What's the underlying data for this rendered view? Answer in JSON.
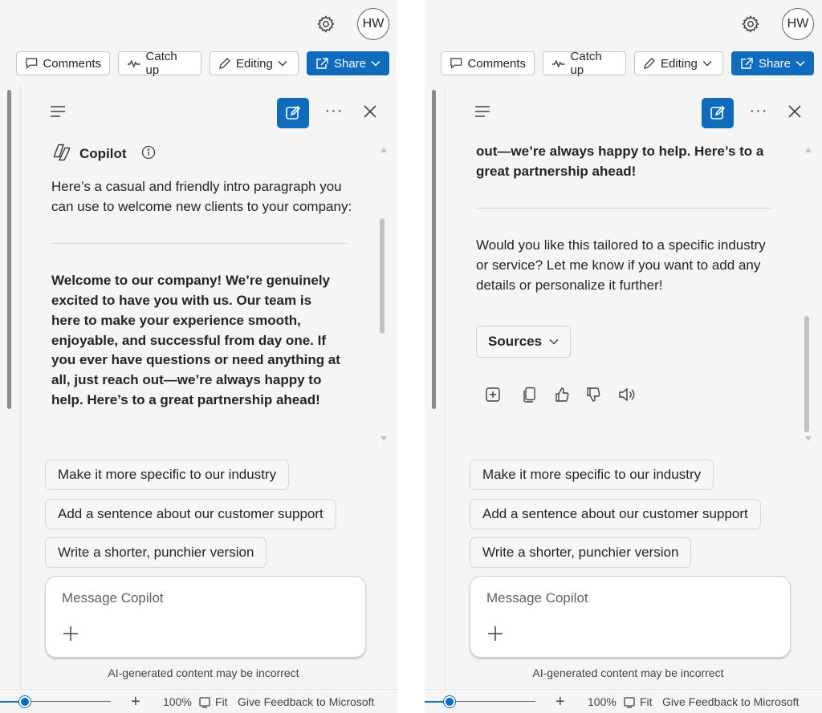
{
  "header": {
    "avatar_initials": "HW",
    "settings_icon": "gear-icon"
  },
  "toolbar": {
    "comments_label": "Comments",
    "catchup_label": "Catch up",
    "editing_label": "Editing",
    "share_label": "Share"
  },
  "copilot": {
    "title": "Copilot",
    "intro": "Here’s a casual and friendly intro paragraph you can use to welcome new clients to your company:",
    "draft_paragraph": "Welcome to our company! We’re genuinely excited to have you with us. Our team is here to make your experience smooth, enjoyable, and successful from day one. If you ever have questions or need anything at all, just reach out—we’re always happy to help. Here’s to a great partnership ahead!",
    "draft_tail": "out—we’re always happy to help. Here’s to a great partnership ahead!",
    "followup": "Would you like this tailored to a specific industry or service? Let me know if you want to add any details or personalize it further!",
    "sources_label": "Sources",
    "suggestions": [
      "Make it more specific to our industry",
      "Add a sentence about our customer support",
      "Write a shorter, punchier version"
    ],
    "composer_placeholder": "Message Copilot",
    "disclaimer": "AI-generated content may be incorrect"
  },
  "status_bar": {
    "zoom_percent": "100%",
    "fit_label": "Fit",
    "feedback_label": "Give Feedback to Microsoft"
  },
  "colors": {
    "accent": "#0f6cbd",
    "background": "#f5f5f5"
  }
}
